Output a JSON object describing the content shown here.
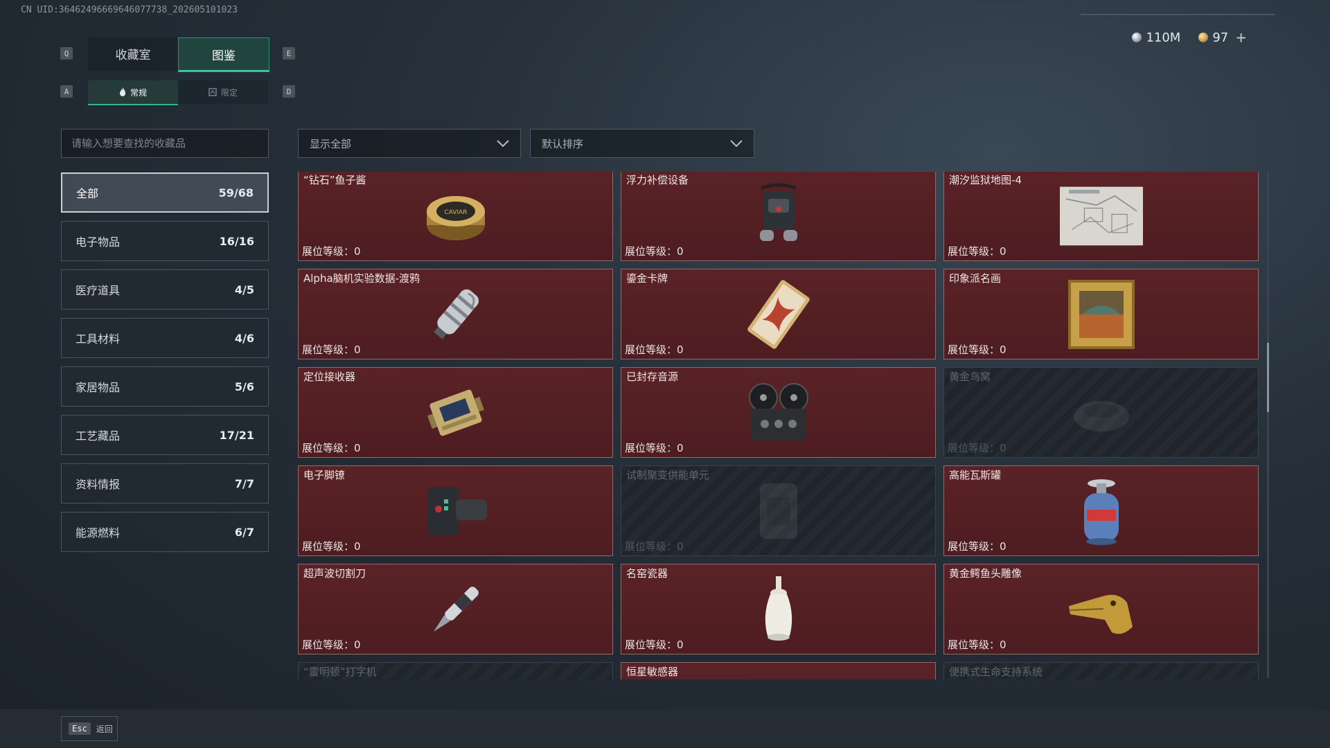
{
  "uid": "CN UID:36462496669646077738_202605101023",
  "currency": {
    "silver": "110M",
    "gold": "97",
    "add": "+"
  },
  "keys": {
    "prev_tab": "Q",
    "next_tab": "E",
    "prev_sub": "A",
    "next_sub": "D"
  },
  "tabs": [
    {
      "label": "收藏室"
    },
    {
      "label": "图鉴"
    }
  ],
  "subtabs": [
    {
      "label": "常规"
    },
    {
      "label": "限定"
    }
  ],
  "search": {
    "placeholder": "请输入想要查找的收藏品"
  },
  "filters": {
    "show": "显示全部",
    "sort": "默认排序"
  },
  "categories": [
    {
      "label": "全部",
      "count": "59/68"
    },
    {
      "label": "电子物品",
      "count": "16/16"
    },
    {
      "label": "医疗道具",
      "count": "4/5"
    },
    {
      "label": "工具材料",
      "count": "4/6"
    },
    {
      "label": "家居物品",
      "count": "5/6"
    },
    {
      "label": "工艺藏品",
      "count": "17/21"
    },
    {
      "label": "资料情报",
      "count": "7/7"
    },
    {
      "label": "能源燃料",
      "count": "6/7"
    }
  ],
  "items": [
    {
      "name": "“钻石”鱼子酱",
      "level": "展位等级：0",
      "icon": "caviar-tin-icon"
    },
    {
      "name": "浮力补偿设备",
      "level": "展位等级：0",
      "icon": "buoyancy-device-icon"
    },
    {
      "name": "潮汐监狱地图-4",
      "level": "展位等级：0",
      "icon": "map-icon"
    },
    {
      "name": "Alpha脑机实验数据-渡鸦",
      "level": "展位等级：0",
      "icon": "data-canister-icon"
    },
    {
      "name": "鎏金卡牌",
      "level": "展位等级：0",
      "icon": "gilded-card-icon"
    },
    {
      "name": "印象派名画",
      "level": "展位等级：0",
      "icon": "painting-icon"
    },
    {
      "name": "定位接收器",
      "level": "展位等级：0",
      "icon": "gps-receiver-icon"
    },
    {
      "name": "已封存音源",
      "level": "展位等级：0",
      "icon": "reel-recorder-icon"
    },
    {
      "name": "黄金鸟窝",
      "level": "展位等级：0",
      "icon": "golden-nest-icon"
    },
    {
      "name": "电子脚镣",
      "level": "展位等级：0",
      "icon": "ankle-monitor-icon"
    },
    {
      "name": "试制聚变供能单元",
      "level": "展位等级：0",
      "icon": "fusion-unit-icon"
    },
    {
      "name": "高能瓦斯罐",
      "level": "展位等级：0",
      "icon": "gas-canister-icon"
    },
    {
      "name": "超声波切割刀",
      "level": "展位等级：0",
      "icon": "ultrasonic-cutter-icon"
    },
    {
      "name": "名窑瓷器",
      "level": "展位等级：0",
      "icon": "porcelain-vase-icon"
    },
    {
      "name": "黄金鳄鱼头雕像",
      "level": "展位等级：0",
      "icon": "gold-crocodile-icon"
    },
    {
      "name": "“雷明顿”打字机",
      "level": "",
      "icon": "typewriter-icon"
    },
    {
      "name": "恒星敏感器",
      "level": "",
      "icon": "star-sensor-icon"
    },
    {
      "name": "便携式生命支持系统",
      "level": "",
      "icon": "life-support-icon"
    }
  ],
  "locked_states": [
    false,
    false,
    false,
    false,
    false,
    false,
    false,
    false,
    true,
    false,
    true,
    false,
    false,
    false,
    false,
    true,
    false,
    true
  ],
  "footer": {
    "esc_key": "Esc",
    "esc_label": "返回"
  }
}
